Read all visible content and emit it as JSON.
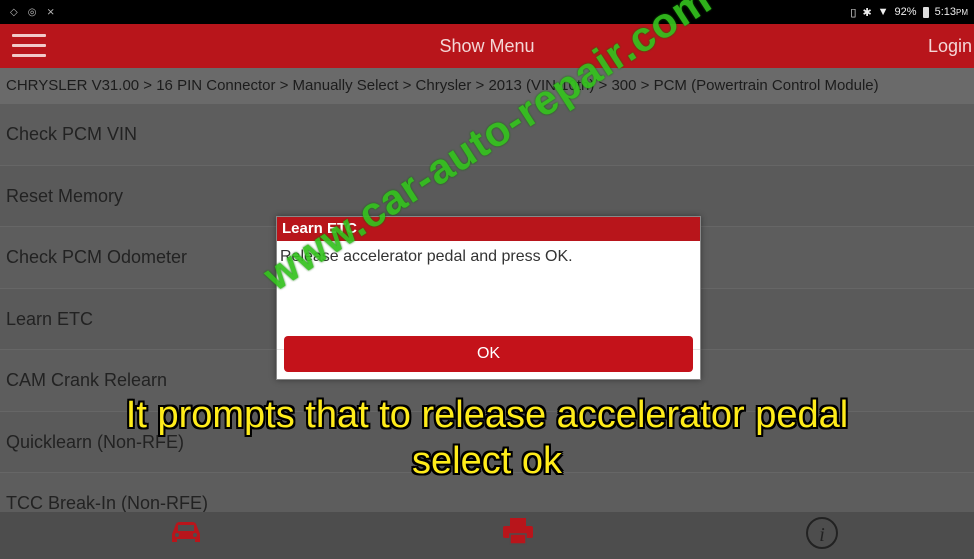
{
  "status_bar": {
    "battery": "92%",
    "time": "5:13",
    "ampm": "PM"
  },
  "header": {
    "title": "Show Menu",
    "login": "Login"
  },
  "breadcrumb": "CHRYSLER V31.00 > 16 PIN Connector > Manually Select > Chrysler > 2013 (VIN 10th) > 300 > PCM (Powertrain Control Module)",
  "menu_items": [
    "Check PCM VIN",
    "Reset Memory",
    "Check PCM Odometer",
    "Learn ETC",
    "CAM Crank Relearn",
    "Quicklearn (Non-RFE)",
    "TCC Break-In (Non-RFE)"
  ],
  "dialog": {
    "title": "Learn ETC",
    "message": "Release accelerator pedal and press OK.",
    "ok": "OK"
  },
  "caption": {
    "line1": "It prompts that to release accelerator pedal",
    "line2": "select ok"
  },
  "watermark": "www.car-auto-repair.com",
  "colors": {
    "header": "#b8151b",
    "ok_button": "#c4121a",
    "caption": "#ffec1a",
    "watermark": "#34c21e"
  }
}
